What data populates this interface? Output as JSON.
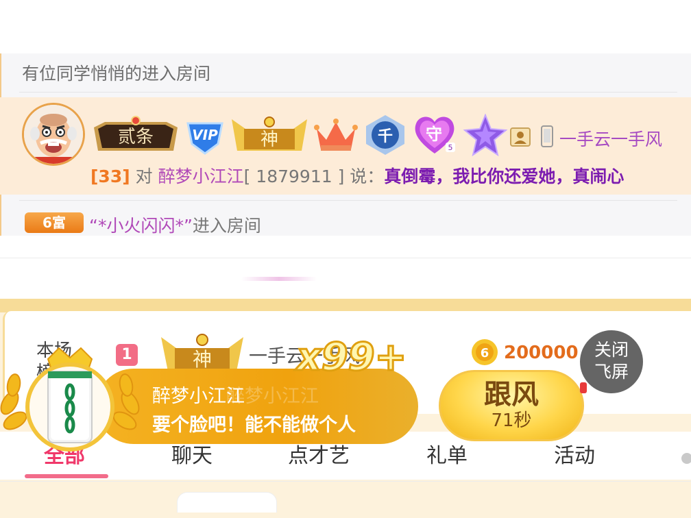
{
  "chat": {
    "notice_text": "有位同学悄悄的进入房间",
    "message": {
      "badges": {
        "ercai": "贰条",
        "vip": "VIP",
        "shen": "神",
        "qian": "千",
        "shou": "守",
        "shou_level": "5"
      },
      "username": "一手云一手风",
      "level": "[33]",
      "to_word": "对",
      "target_name": "醉梦小江江",
      "target_id": "[ 1879911 ]",
      "say_word": "说：",
      "content": "真倒霉，我比你还爱她，真闹心"
    },
    "enter": {
      "rich_badge": "6富",
      "quote_name": "“*小火闪闪*”",
      "text": "进入房间"
    }
  },
  "rank": {
    "title": "本场榜单",
    "number": "1",
    "shen_badge": "神",
    "name": "一手云一手风",
    "coin_icon_label": "6",
    "amount": "200000"
  },
  "close_fly": {
    "line1": "关闭",
    "line2": "飞屏"
  },
  "fly_screen": {
    "multiplier": "x99+",
    "name": "醉梦小江江",
    "message": "要个脸吧！能不能做个人",
    "follow_label": "跟风",
    "countdown": "71秒"
  },
  "tabs": [
    {
      "label": "全部"
    },
    {
      "label": "聊天"
    },
    {
      "label": "点才艺"
    },
    {
      "label": "礼单"
    },
    {
      "label": "活动"
    }
  ],
  "colors": {
    "accent_pink": "#f0386a",
    "coin_orange": "#e36c1c",
    "purple_name": "#a64ac2",
    "fly_gold": "#f0a20e"
  }
}
